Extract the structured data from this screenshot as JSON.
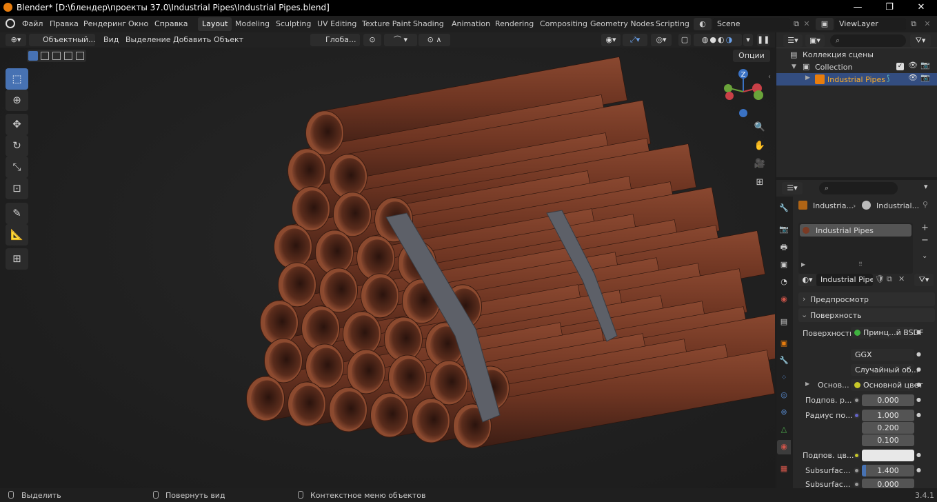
{
  "window": {
    "title": "Blender* [D:\\блендер\\проекты 37.0\\Industrial Pipes\\Industrial Pipes.blend]",
    "minimize": "—",
    "maximize": "❐",
    "close": "✕"
  },
  "menu": {
    "items": [
      "Файл",
      "Правка",
      "Рендеринг",
      "Окно",
      "Справка"
    ]
  },
  "workspaces": [
    "Layout",
    "Modeling",
    "Sculpting",
    "UV Editing",
    "Texture Paint",
    "Shading",
    "Animation",
    "Rendering",
    "Compositing",
    "Geometry Nodes",
    "Scripting"
  ],
  "scene": {
    "name": "Scene",
    "view_layer": "ViewLayer"
  },
  "viewport": {
    "mode": "Объектный...",
    "menus": [
      "Вид",
      "Выделение",
      "Добавить",
      "Объект"
    ],
    "transform_orientation": "Глоба...",
    "options": "Опции",
    "gizmo_axes": {
      "z": "Z",
      "x": "X",
      "y": "Y"
    }
  },
  "outliner": {
    "scene_collection": "Коллекция сцены",
    "collection": "Collection",
    "object": "Industrial Pipes"
  },
  "properties": {
    "breadcrumb": [
      "Industria...",
      "Industrial..."
    ],
    "slot": "Industrial Pipes",
    "material": "Industrial Pipes",
    "sections": {
      "preview": "Предпросмотр",
      "surface": "Поверхность"
    },
    "rows": {
      "surface_label": "Поверхность",
      "surface_value": "Принц...й BSDF",
      "distribution": "GGX",
      "subsurface_method": "Случайный об...",
      "base_label": "Основ...",
      "base_value": "Основной цвет",
      "subsurface_label": "Подпов. р...",
      "subsurface_value": "0.000",
      "radius_label": "Радиус по...",
      "radius_values": [
        "1.000",
        "0.200",
        "0.100"
      ],
      "subsurface_color_label": "Подпов. цв...",
      "subsurface_color": "#e8e8e8",
      "ior_label": "Subsurfac...",
      "ior_value": "1.400",
      "aniso_label": "Subsurfac...",
      "aniso_value": "0.000"
    }
  },
  "status": {
    "select": "Выделить",
    "rotate": "Повернуть вид",
    "context": "Контекстное меню объектов",
    "version": "3.4.1"
  },
  "colors": {
    "accent": "#4772b3",
    "pipe_rust": "#7a3a24",
    "strap": "#5d6068",
    "x_axis": "#c94047",
    "y_axis": "#6aa33a",
    "z_axis": "#3a72c4",
    "orange": "#e87d0d"
  }
}
